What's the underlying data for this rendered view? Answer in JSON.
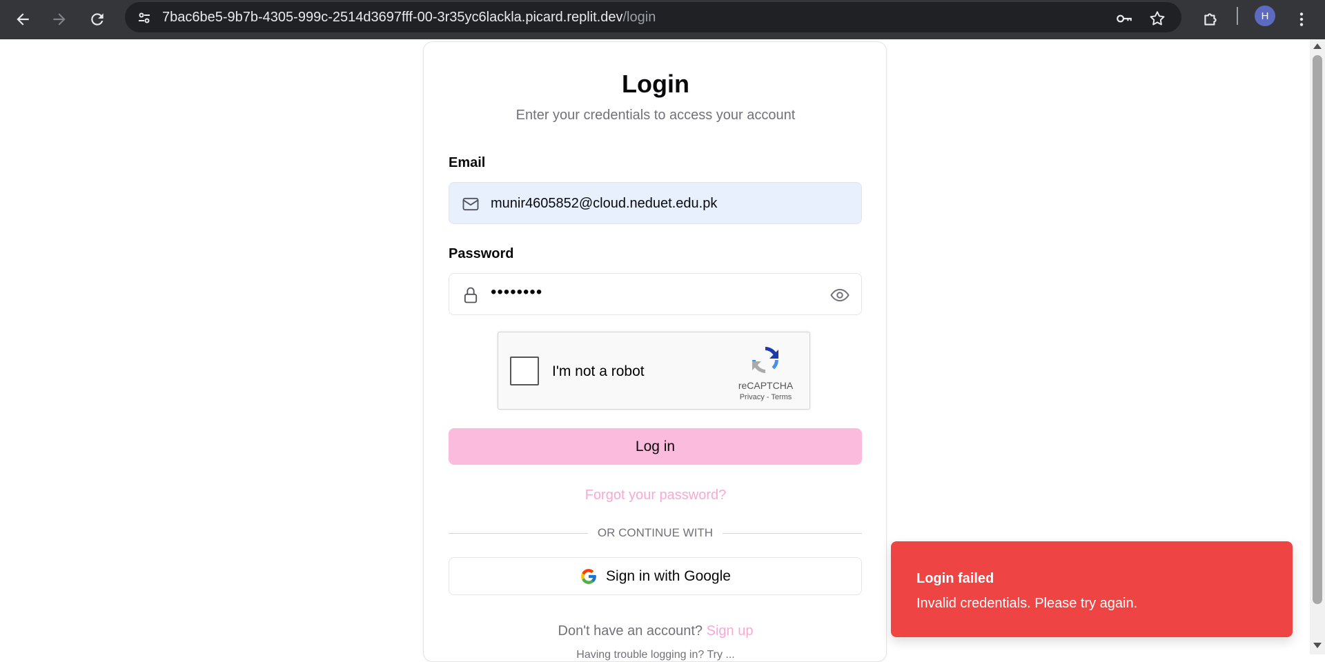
{
  "browser": {
    "url_host": "7bac6be5-9b7b-4305-999c-2514d3697fff-00-3r35yc6lackla.picard.replit.dev",
    "url_path": "/login",
    "avatar_initial": "H"
  },
  "login": {
    "title": "Login",
    "subtitle": "Enter your credentials to access your account",
    "email_label": "Email",
    "email_value": "munir4605852@cloud.neduet.edu.pk",
    "password_label": "Password",
    "password_masked": "••••••••",
    "captcha_text": "I'm not a robot",
    "captcha_brand": "reCAPTCHA",
    "captcha_links": "Privacy - Terms",
    "login_button": "Log in",
    "forgot_link": "Forgot your password?",
    "divider_text": "OR CONTINUE WITH",
    "google_button": "Sign in with Google",
    "signup_prompt": "Don't have an account?",
    "signup_link": "Sign up",
    "trouble_text": "Having trouble logging in? Try ..."
  },
  "toast": {
    "title": "Login failed",
    "message": "Invalid credentials. Please try again.",
    "color": "#ef4444"
  },
  "colors": {
    "accent_pink": "#fbbbdd",
    "link_pink": "#f9a8d4",
    "autofill_blue": "#e8f0fe"
  }
}
